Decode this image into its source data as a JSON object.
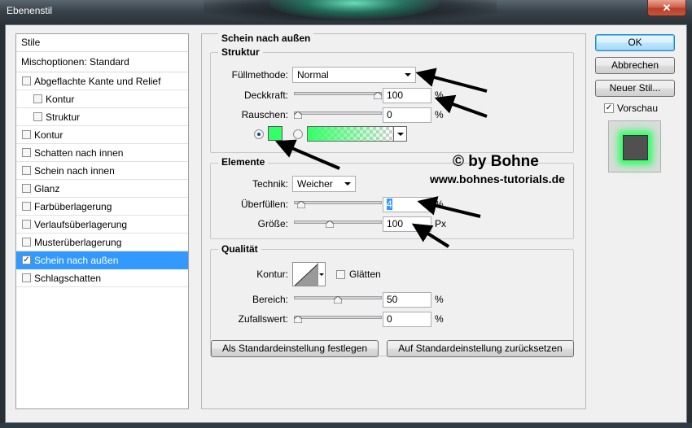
{
  "window": {
    "title": "Ebenenstil",
    "close_glyph": "✕"
  },
  "sidebar": {
    "header": "Stile",
    "blend_options": "Mischoptionen: Standard",
    "items": [
      {
        "label": "Abgeflachte Kante und Relief",
        "checked": false,
        "sub": false
      },
      {
        "label": "Kontur",
        "checked": false,
        "sub": true
      },
      {
        "label": "Struktur",
        "checked": false,
        "sub": true
      },
      {
        "label": "Kontur",
        "checked": false,
        "sub": false
      },
      {
        "label": "Schatten nach innen",
        "checked": false,
        "sub": false
      },
      {
        "label": "Schein nach innen",
        "checked": false,
        "sub": false
      },
      {
        "label": "Glanz",
        "checked": false,
        "sub": false
      },
      {
        "label": "Farbüberlagerung",
        "checked": false,
        "sub": false
      },
      {
        "label": "Verlaufsüberlagerung",
        "checked": false,
        "sub": false
      },
      {
        "label": "Musterüberlagerung",
        "checked": false,
        "sub": false
      },
      {
        "label": "Schein nach außen",
        "checked": true,
        "sub": false,
        "selected": true
      },
      {
        "label": "Schlagschatten",
        "checked": false,
        "sub": false
      }
    ]
  },
  "panel": {
    "title": "Schein nach außen",
    "struktur": {
      "title": "Struktur",
      "blend_mode_label": "Füllmethode:",
      "blend_mode_value": "Normal",
      "opacity_label": "Deckkraft:",
      "opacity_value": "100",
      "opacity_unit": "%",
      "opacity_level": 100,
      "noise_label": "Rauschen:",
      "noise_value": "0",
      "noise_unit": "%",
      "noise_level": 0,
      "color": "#33ff66"
    },
    "elemente": {
      "title": "Elemente",
      "technique_label": "Technik:",
      "technique_value": "Weicher",
      "spread_label": "Überfüllen:",
      "spread_value": "4",
      "spread_unit": "%",
      "spread_level": 4,
      "size_label": "Größe:",
      "size_value": "100",
      "size_unit": "Px",
      "size_level": 40
    },
    "qualitaet": {
      "title": "Qualität",
      "contour_label": "Kontur:",
      "antialias_label": "Glätten",
      "range_label": "Bereich:",
      "range_value": "50",
      "range_unit": "%",
      "range_level": 50,
      "jitter_label": "Zufallswert:",
      "jitter_value": "0",
      "jitter_unit": "%",
      "jitter_level": 0
    },
    "buttons": {
      "set_default": "Als Standardeinstellung festlegen",
      "reset_default": "Auf Standardeinstellung zurücksetzen"
    }
  },
  "actions": {
    "ok": "OK",
    "cancel": "Abbrechen",
    "new_style": "Neuer Stil...",
    "preview_label": "Vorschau",
    "preview_checked": true
  },
  "watermark": {
    "line1": "© by Bohne",
    "line2": "www.bohnes-tutorials.de"
  },
  "colors": {
    "accent": "#3399ff",
    "glow": "#33ff66",
    "close": "#c7553c"
  }
}
